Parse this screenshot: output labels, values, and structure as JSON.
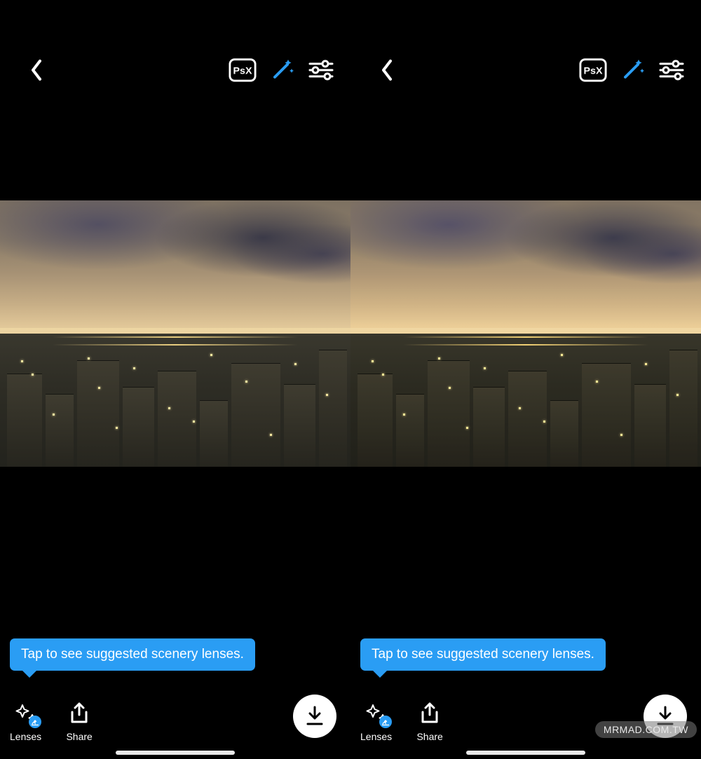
{
  "panes": [
    {
      "top": {
        "psx_label": "PsX"
      },
      "tooltip": "Tap to see suggested scenery lenses.",
      "bottom": {
        "lenses_label": "Lenses",
        "share_label": "Share"
      }
    },
    {
      "top": {
        "psx_label": "PsX"
      },
      "tooltip": "Tap to see suggested scenery lenses.",
      "bottom": {
        "lenses_label": "Lenses",
        "share_label": "Share"
      }
    }
  ],
  "watermark": "MRMAD.COM.TW",
  "colors": {
    "accent": "#2a9df4"
  }
}
